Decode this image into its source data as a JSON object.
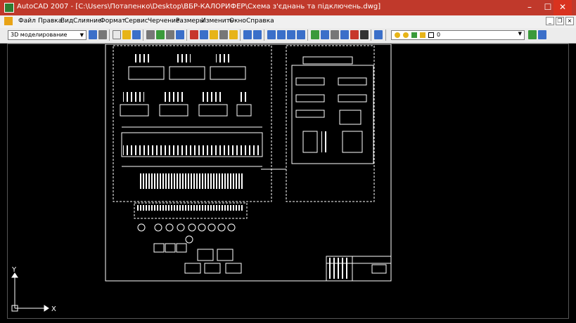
{
  "window": {
    "title": "AutoCAD 2007 - [C:\\Users\\Потапенко\\Desktop\\ВБР-КАЛОРИФЕР\\Схема з'єднань та підключень.dwg]",
    "controls": {
      "minimize": "–",
      "maximize": "☐",
      "close": "✕"
    }
  },
  "menu": {
    "items": [
      "Файл",
      "Правка",
      "Вид",
      "Слияние",
      "Формат",
      "Сервис",
      "Черчение",
      "Размеры",
      "Изменить",
      "Окно",
      "Справка"
    ],
    "doc_controls": {
      "minimize": "_",
      "restore": "❐",
      "close": "×"
    }
  },
  "toolbar": {
    "workspace": "3D моделирование",
    "layer_value": "0",
    "colors": {
      "blue": "#3b6fc9",
      "green": "#3a9a3a",
      "yellow": "#e7b418",
      "red": "#c7372b",
      "gray": "#777777"
    }
  },
  "canvas": {
    "background": "#000000",
    "line_color": "#ffffff",
    "ucs": {
      "x_label": "X",
      "y_label": "Y"
    }
  }
}
